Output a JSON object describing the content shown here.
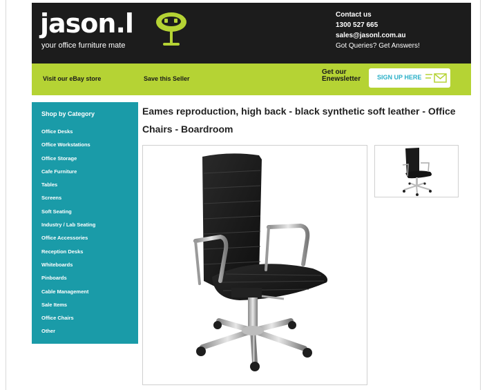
{
  "header": {
    "logo_text": "jason.l",
    "tagline": "your office furniture mate",
    "contact": {
      "heading": "Contact us",
      "phone": "1300 527 665",
      "email": "sales@jasonl.com.au",
      "queries": "Got Queries? Get Answers!"
    }
  },
  "navbar": {
    "ebay_link": "Visit our eBay store",
    "save_link": "Save this Seller",
    "newsletter_line1": "Get our",
    "newsletter_line2": "Enewsletter",
    "signup_label": "SIGN UP HERE"
  },
  "sidebar": {
    "heading": "Shop by Category",
    "items": [
      {
        "label": "Office Desks"
      },
      {
        "label": "Office Workstations"
      },
      {
        "label": "Office Storage"
      },
      {
        "label": "Cafe Furniture"
      },
      {
        "label": "Tables"
      },
      {
        "label": "Screens"
      },
      {
        "label": "Soft Seating"
      },
      {
        "label": "Industry / Lab Seating"
      },
      {
        "label": "Office Accessories"
      },
      {
        "label": "Reception Desks"
      },
      {
        "label": "Whiteboards"
      },
      {
        "label": "Pinboards"
      },
      {
        "label": "Cable Management"
      },
      {
        "label": "Sale Items"
      },
      {
        "label": "Office Chairs"
      },
      {
        "label": "Other"
      }
    ]
  },
  "product": {
    "title": "Eames reproduction, high back - black synthetic soft leather - Office Chairs - Boardroom"
  },
  "colors": {
    "header_bg": "#1c1c1c",
    "accent_green": "#b5d334",
    "sidebar_teal": "#1a9ba8"
  }
}
